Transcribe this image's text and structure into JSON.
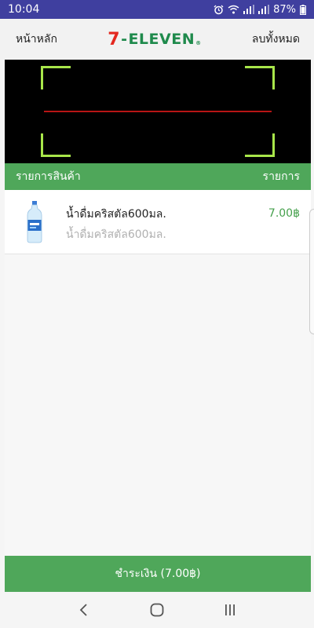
{
  "status_bar": {
    "time": "10:04",
    "battery": "87%"
  },
  "header": {
    "home_label": "หน้าหลัก",
    "clear_all_label": "ลบทั้งหมด",
    "logo_seven": "7",
    "logo_dash": "-",
    "logo_eleven": "ELEVEN",
    "logo_reg": "®"
  },
  "list_header": {
    "left": "รายการสินค้า",
    "right": "รายการ"
  },
  "items": [
    {
      "name": "น้ำดื่มคริสตัล600มล.",
      "subtitle": "น้ำดื่มคริสตัล600มล.",
      "price": "7.00฿"
    }
  ],
  "pay_button": {
    "label": "ชำระเงิน (7.00฿)"
  },
  "colors": {
    "status_bar": "#3f3f9f",
    "accent_green": "#4fa75a",
    "scan_line": "#b81515",
    "frame_corner": "#a8e64a",
    "logo_red": "#e4281f"
  },
  "icons": {
    "back": "back-icon",
    "home": "home-icon",
    "recents": "recents-icon"
  }
}
